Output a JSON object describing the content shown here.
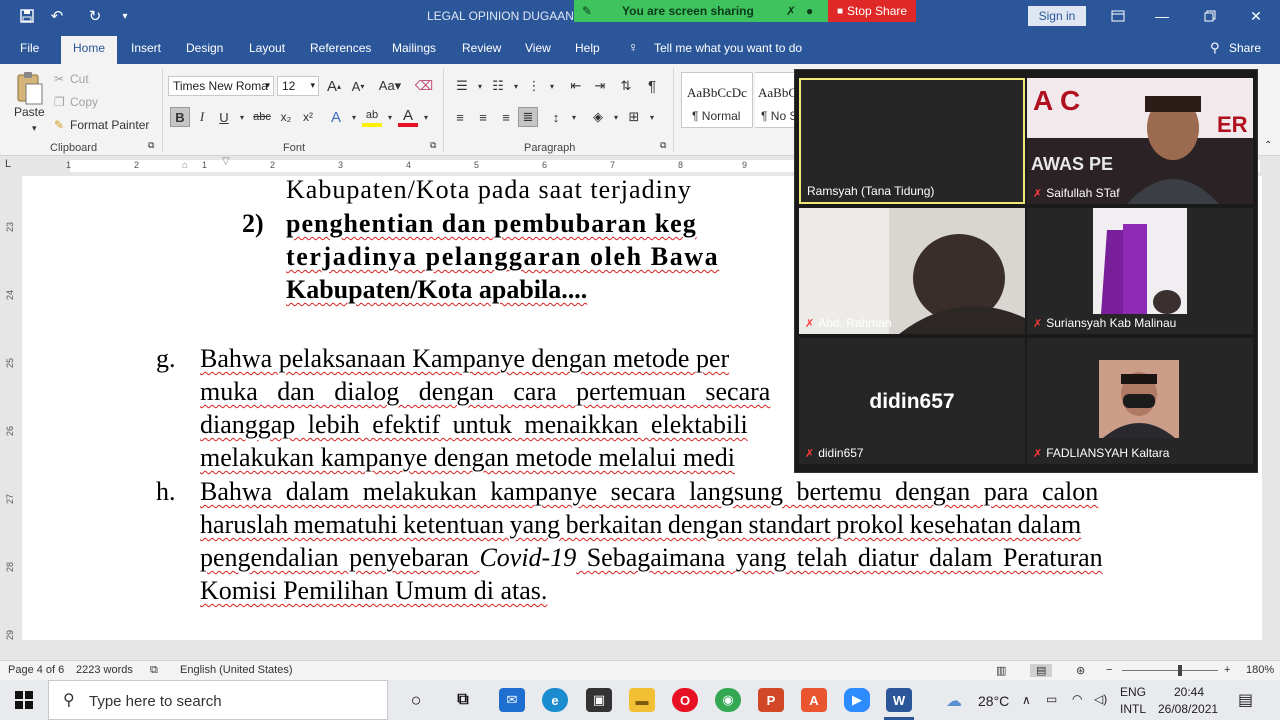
{
  "title_bar": {
    "doc_title": "LEGAL OPINION DUGAAN P",
    "sign_in": "Sign in",
    "icons": [
      "save-icon",
      "undo-icon",
      "redo-icon",
      "customize-icon"
    ]
  },
  "screen_share": {
    "status": "You are screen sharing",
    "stop": "Stop Share"
  },
  "tabs": [
    "File",
    "Home",
    "Insert",
    "Design",
    "Layout",
    "References",
    "Mailings",
    "Review",
    "View",
    "Help"
  ],
  "tell_me": "Tell me what you want to do",
  "share": "Share",
  "ribbon": {
    "clipboard": {
      "label": "Clipboard",
      "paste": "Paste",
      "cut": "Cut",
      "copy": "Copy",
      "format_painter": "Format Painter"
    },
    "font": {
      "label": "Font",
      "font_name": "Times New Roma",
      "font_size": "12"
    },
    "paragraph": {
      "label": "Paragraph"
    },
    "styles": {
      "normal_sample": "AaBbCcDc",
      "normal_label": "¶ Normal",
      "nospace_sample": "AaBbC",
      "nospace_label": "¶ No S"
    }
  },
  "ruler_numbers": [
    "1",
    "2",
    "1",
    "2",
    "3",
    "4",
    "5",
    "6",
    "7",
    "8",
    "9",
    "10"
  ],
  "vruler_numbers": [
    "23",
    "24",
    "25",
    "26",
    "27",
    "28",
    "29"
  ],
  "document": {
    "l1": "Kabupaten/Kota pada saat terjadiny",
    "l2_num": "2)",
    "l2": "penghentian dan pembubaran keg",
    "l3": "terjadinya pelanggaran oleh Bawa",
    "l4": "Kabupaten/Kota apabila....",
    "g_marker": "g.",
    "g1": "Bahwa pelaksanaan Kampanye dengan metode per",
    "g2": "muka dan dialog dengan cara pertemuan secara",
    "g3": "dianggap lebih efektif untuk menaikkan elektabili",
    "g4": "melakukan kampanye dengan metode melalui medi",
    "h_marker": "h.",
    "h1": "Bahwa dalam melakukan kampanye secara langsung bertemu dengan para calon",
    "h2": "haruslah mematuhi ketentuan yang  berkaitan dengan standart prokol kesehatan dalam",
    "h3_a": "pengendalian penyebaran ",
    "h3_i": "Covid-19",
    "h3_b": " Sebagaimana yang telah diatur dalam Peraturan",
    "h4": "Komisi Pemilihan Umum di atas."
  },
  "participants": [
    {
      "name": "Ramsyah (Tana Tidung)",
      "muted": false,
      "active": true
    },
    {
      "name": "Saifullah STaf",
      "muted": true
    },
    {
      "name": "Abd. Rahman",
      "muted": true
    },
    {
      "name": "Suriansyah Kab Malinau",
      "muted": true
    },
    {
      "name": "didin657",
      "muted": true,
      "avatar_text": "didin657"
    },
    {
      "name": "FADLIANSYAH Kaltara",
      "muted": true
    }
  ],
  "status_bar": {
    "page": "Page 4 of 6",
    "words": "2223 words",
    "language": "English (United States)",
    "zoom": "180%"
  },
  "taskbar": {
    "search_placeholder": "Type here to search",
    "weather": "28°C",
    "lang1": "ENG",
    "lang2": "INTL",
    "time": "20:44",
    "date": "26/08/2021"
  },
  "colors": {
    "word_blue": "#2b579a",
    "share_green": "#3ec35f",
    "stop_red": "#e02828",
    "active_speaker": "#f0e97a"
  }
}
